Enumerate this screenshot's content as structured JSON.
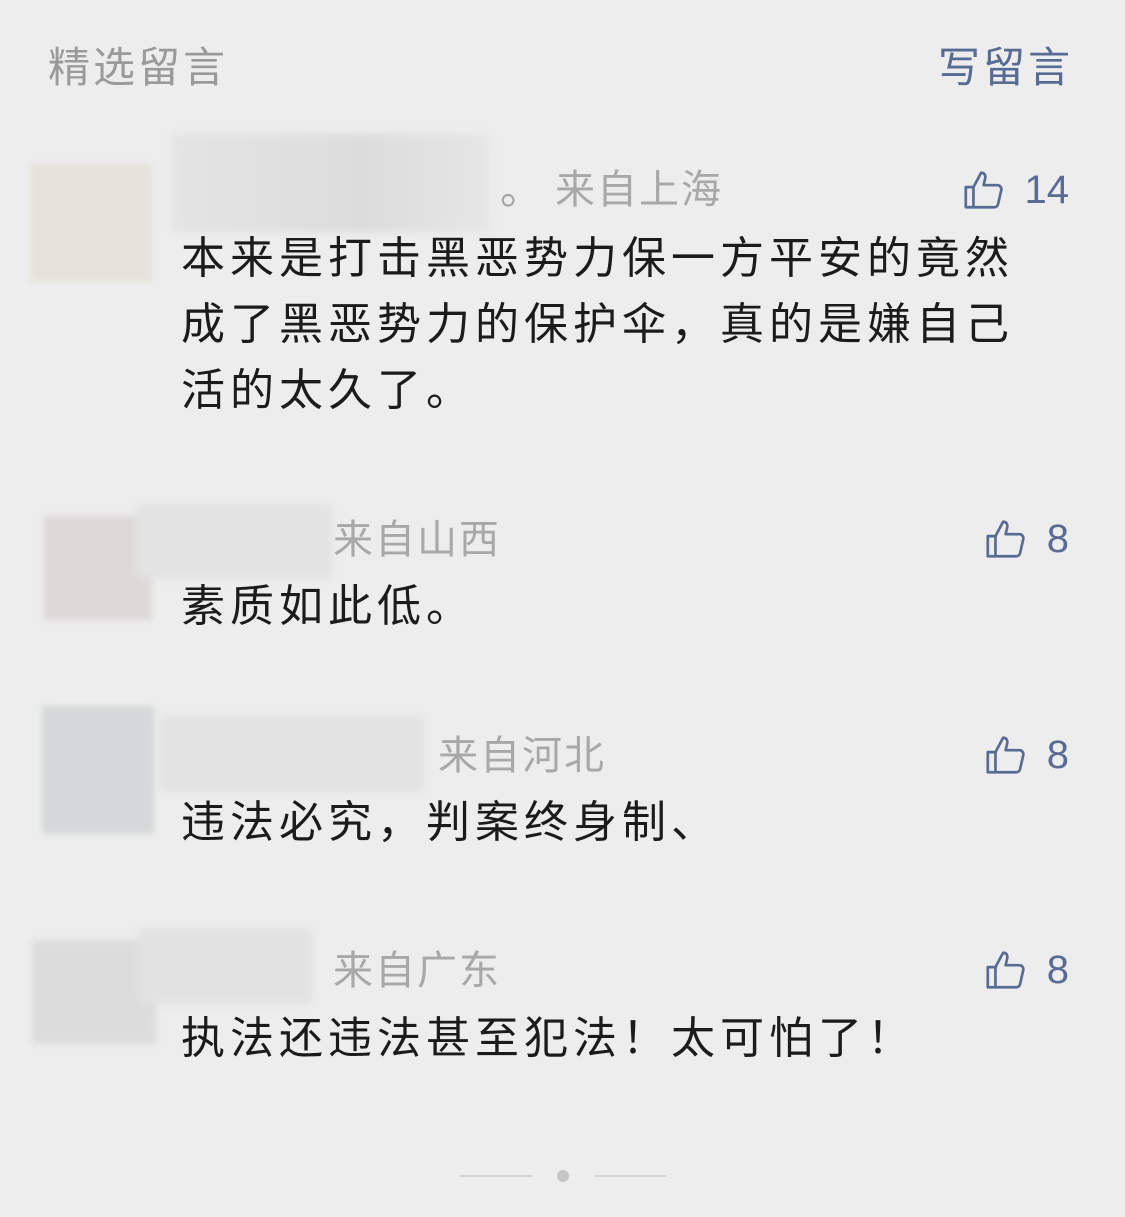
{
  "header": {
    "title": "精选留言",
    "write_label": "写留言"
  },
  "comments": [
    {
      "name_suffix": "。",
      "location": "来自上海",
      "likes": "14",
      "content": "本来是打击黑恶势力保一方平安的竟然\n成了黑恶势力的保护伞，真的是嫌自己\n活的太久了。"
    },
    {
      "name_suffix": "",
      "location": "来自山西",
      "likes": "8",
      "content": "素质如此低。"
    },
    {
      "name_suffix": "",
      "location": "来自河北",
      "likes": "8",
      "content": "违法必究，判案终身制、"
    },
    {
      "name_suffix": "",
      "location": "来自广东",
      "likes": "8",
      "content": "执法还违法甚至犯法！太可怕了！"
    }
  ],
  "colors": {
    "link": "#576b95",
    "muted_text": "#a8a8a8",
    "body_text": "#1b1b1b",
    "background": "#ededed"
  },
  "icons": {
    "like": "thumbs-up-icon"
  }
}
